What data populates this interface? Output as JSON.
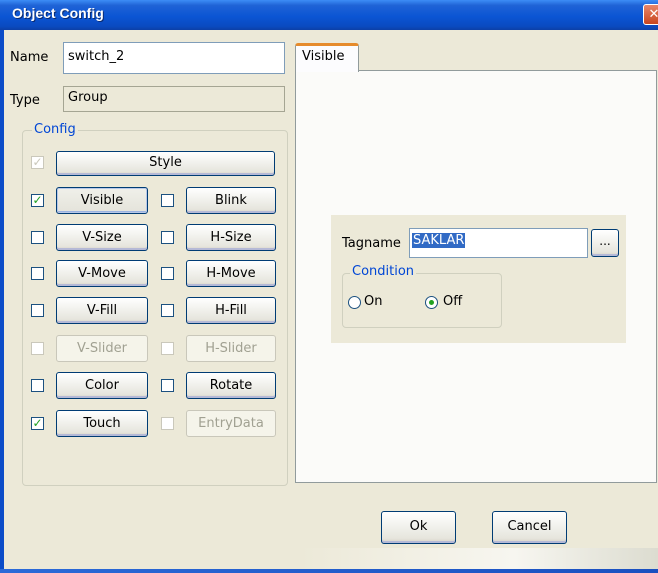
{
  "window": {
    "title": "Object Config",
    "close_glyph": "✕"
  },
  "name_label": "Name",
  "name_value": "switch_2",
  "type_label": "Type",
  "type_value": "Group",
  "config_group": {
    "caption": "Config",
    "rows": [
      {
        "checked": true,
        "enabled": false,
        "label": "Style",
        "button_enabled": true
      },
      {
        "checked": true,
        "enabled": true,
        "label": "Visible",
        "button_enabled": true,
        "active": true
      },
      {
        "checked": false,
        "enabled": true,
        "label": "Blink",
        "button_enabled": true
      },
      {
        "checked": false,
        "enabled": true,
        "label": "V-Size",
        "button_enabled": true
      },
      {
        "checked": false,
        "enabled": true,
        "label": "H-Size",
        "button_enabled": true
      },
      {
        "checked": false,
        "enabled": true,
        "label": "V-Move",
        "button_enabled": true
      },
      {
        "checked": false,
        "enabled": true,
        "label": "H-Move",
        "button_enabled": true
      },
      {
        "checked": false,
        "enabled": true,
        "label": "V-Fill",
        "button_enabled": true
      },
      {
        "checked": false,
        "enabled": true,
        "label": "H-Fill",
        "button_enabled": true
      },
      {
        "checked": false,
        "enabled": false,
        "label": "V-Slider",
        "button_enabled": false
      },
      {
        "checked": false,
        "enabled": false,
        "label": "H-Slider",
        "button_enabled": false
      },
      {
        "checked": false,
        "enabled": true,
        "label": "Color",
        "button_enabled": true
      },
      {
        "checked": false,
        "enabled": true,
        "label": "Rotate",
        "button_enabled": true
      },
      {
        "checked": true,
        "enabled": true,
        "label": "Touch",
        "button_enabled": true
      },
      {
        "checked": false,
        "enabled": false,
        "label": "EntryData",
        "button_enabled": false
      }
    ]
  },
  "tabs": [
    {
      "label": "Visible",
      "selected": true
    }
  ],
  "visible_panel": {
    "tagname_label": "Tagname",
    "tagname_value": "SAKLAR",
    "browse_label": "...",
    "condition_caption": "Condition",
    "options": [
      {
        "label": "On",
        "selected": false
      },
      {
        "label": "Off",
        "selected": true
      }
    ]
  },
  "buttons": {
    "ok": "Ok",
    "cancel": "Cancel"
  },
  "check_glyph": "✓",
  "colors": {
    "title_blue": "#0b55d4",
    "accent_green": "#21a121",
    "caption_blue": "#0046d5",
    "selection": "#316ac5",
    "tab_accent": "#e68b2c"
  }
}
